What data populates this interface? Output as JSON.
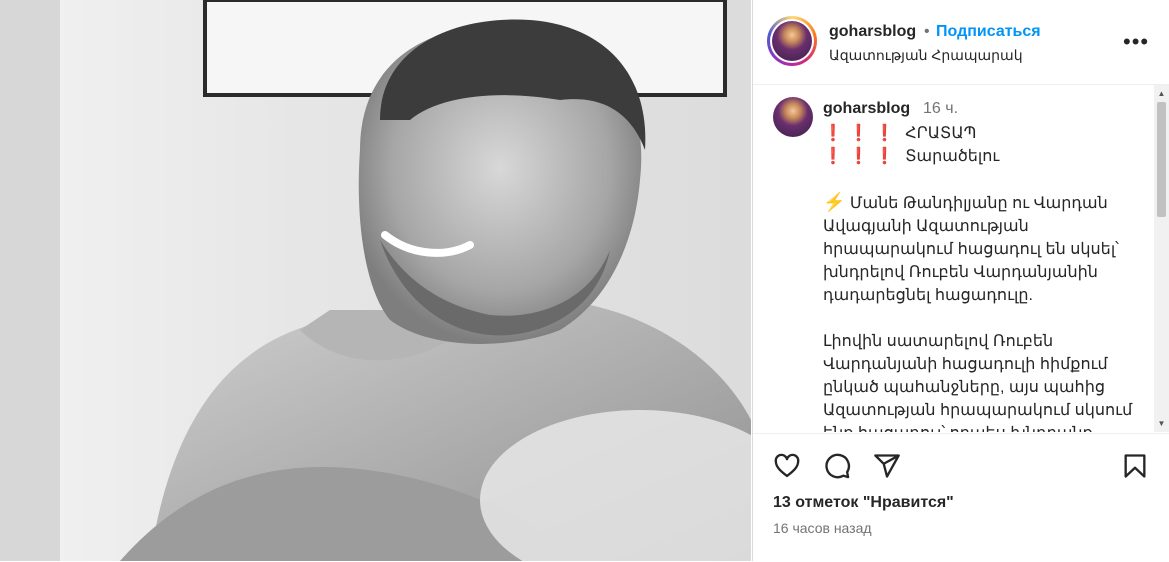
{
  "post": {
    "username": "goharsblog",
    "dot": "•",
    "follow_label": "Подписаться",
    "location": "Ազատության Հրապարակ",
    "more_icon": "more-horizontal-icon"
  },
  "caption": {
    "username": "goharsblog",
    "time": "16 ч.",
    "line1_marks": "❗❗❗",
    "line1_text": "ՀՐԱՏԱՊ",
    "line2_marks": "❗❗❗",
    "line2_text": "Տարածելու",
    "p1": [
      "Մանե Թանդիլյանը ու Վարդան",
      "Ավագյանի Ազատության",
      "հրապարակում հացադուլ են սկսել՝",
      "խնդրելով Ռուբեն Վարդանյանին",
      "դադարեցնել հացադուլը."
    ],
    "p2": [
      "Լիովին սատարելով Ռուբեն",
      "Վարդանյանի հացադուլի հիմքում",
      "ընկած պահանջները, այս պահից",
      "Ազատության հրապարակում սկսում",
      "ենք հացադուլ՝ որպես խնդրանք"
    ]
  },
  "actions": {
    "like_icon": "heart-icon",
    "comment_icon": "comment-icon",
    "share_icon": "share-icon",
    "save_icon": "bookmark-icon",
    "likes_text": "13 отметок \"Нравится\"",
    "posted_ago": "16 часов назад"
  }
}
